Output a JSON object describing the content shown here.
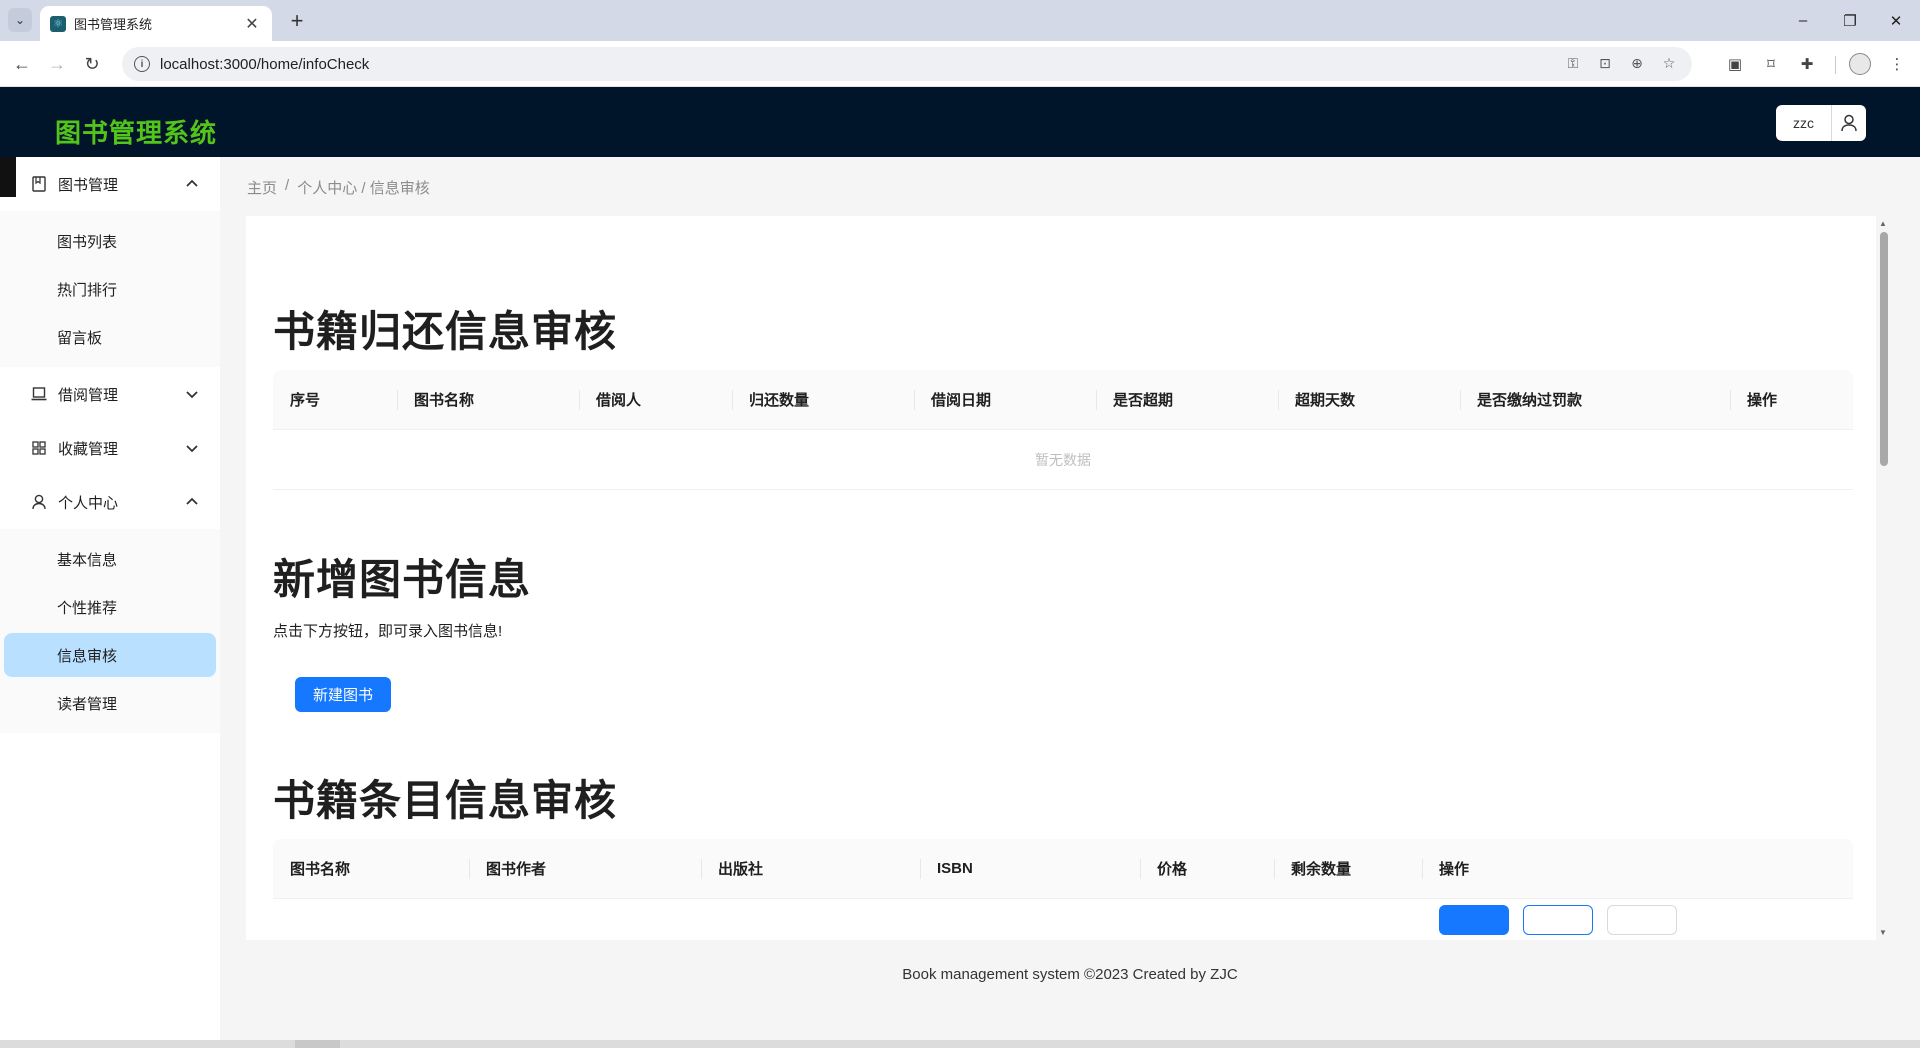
{
  "browser": {
    "tab_title": "图书管理系统",
    "tab_close": "✕",
    "new_tab": "+",
    "url": "localhost:3000/home/infoCheck",
    "window_controls": {
      "minimize": "–",
      "restore": "❐",
      "close": "✕"
    }
  },
  "header": {
    "logo": "图书管理系统",
    "username": "zzc"
  },
  "sidebar": {
    "groups": [
      {
        "label": "图书管理",
        "icon": "book-icon",
        "expanded": true,
        "items": [
          {
            "label": "图书列表"
          },
          {
            "label": "热门排行"
          },
          {
            "label": "留言板"
          }
        ]
      },
      {
        "label": "借阅管理",
        "icon": "laptop-icon",
        "expanded": false
      },
      {
        "label": "收藏管理",
        "icon": "appstore-icon",
        "expanded": false
      },
      {
        "label": "个人中心",
        "icon": "user-icon",
        "expanded": true,
        "items": [
          {
            "label": "基本信息"
          },
          {
            "label": "个性推荐"
          },
          {
            "label": "信息审核",
            "active": true
          },
          {
            "label": "读者管理"
          }
        ]
      }
    ]
  },
  "breadcrumb": {
    "home": "主页",
    "separator": "/",
    "trail": "个人中心 / 信息审核"
  },
  "return_section": {
    "title": "书籍归还信息审核",
    "columns": [
      "序号",
      "图书名称",
      "借阅人",
      "归还数量",
      "借阅日期",
      "是否超期",
      "超期天数",
      "是否缴纳过罚款",
      "操作"
    ],
    "empty_text": "暂无数据"
  },
  "add_section": {
    "title": "新增图书信息",
    "description": "点击下方按钮，即可录入图书信息!",
    "button_label": "新建图书"
  },
  "catalog_section": {
    "title": "书籍条目信息审核",
    "columns": [
      "图书名称",
      "图书作者",
      "出版社",
      "ISBN",
      "价格",
      "剩余数量",
      "操作"
    ],
    "peek_row": {
      "cells": [
        "",
        "",
        "",
        "",
        "",
        ""
      ],
      "actions": [
        "",
        "",
        ""
      ]
    }
  },
  "footer": {
    "text": "Book management system ©2023 Created by ZJC"
  },
  "colors": {
    "header_bg": "#001529",
    "logo": "#52c41a",
    "primary": "#1677ff",
    "active_menu": "#bae0ff"
  }
}
